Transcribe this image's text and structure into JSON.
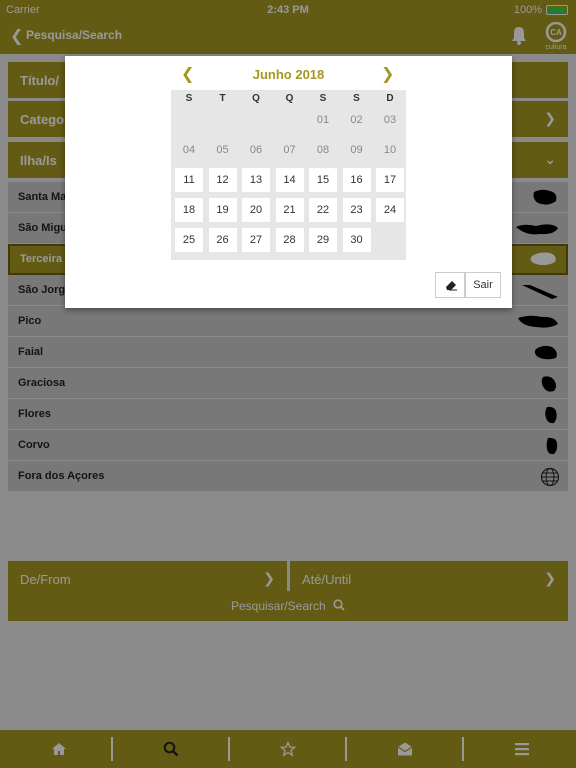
{
  "status": {
    "carrier": "Carrier",
    "time": "2:43 PM",
    "battery": "100%"
  },
  "nav": {
    "title": "Pesquisa/Search",
    "logo_text": "cultura"
  },
  "form": {
    "title_row": "Título/",
    "category_row": "Catego",
    "island_row": "Ilha/Is",
    "islands": [
      "Santa Ma",
      "São Migu",
      "Terceira",
      "São Jorge",
      "Pico",
      "Faial",
      "Graciosa",
      "Flores",
      "Corvo",
      "Fora dos Açores"
    ],
    "selected_island_index": 2,
    "from_label": "De/From",
    "until_label": "Até/Until",
    "search_label": "Pesquisar/Search"
  },
  "calendar": {
    "month_label": "Junho 2018",
    "weekdays": [
      "S",
      "T",
      "Q",
      "Q",
      "S",
      "S",
      "D"
    ],
    "weeks": [
      [
        null,
        null,
        null,
        null,
        "01",
        "02",
        "03"
      ],
      [
        "04",
        "05",
        "06",
        "07",
        "08",
        "09",
        "10"
      ],
      [
        "11",
        "12",
        "13",
        "14",
        "15",
        "16",
        "17"
      ],
      [
        "18",
        "19",
        "20",
        "21",
        "22",
        "23",
        "24"
      ],
      [
        "25",
        "26",
        "27",
        "28",
        "29",
        "30",
        null
      ]
    ],
    "first_selectable_day": 11,
    "exit_label": "Sair"
  },
  "tabs": [
    "home-icon",
    "search-icon",
    "star-icon",
    "mail-icon",
    "menu-icon"
  ],
  "colors": {
    "accent": "#a59722",
    "background": "#e6e6e6"
  }
}
